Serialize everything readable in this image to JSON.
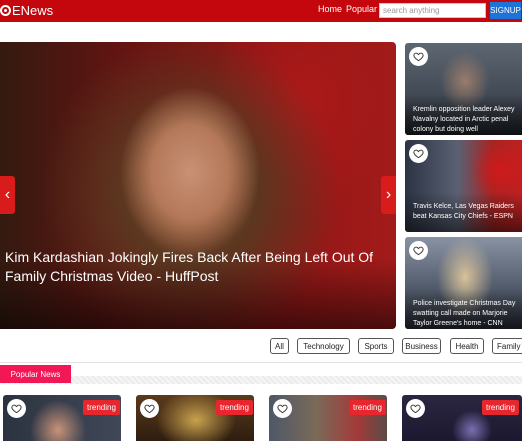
{
  "header": {
    "logo_text": "ENews",
    "nav": [
      "Home",
      "Popular"
    ],
    "search_placeholder": "search anything",
    "signup_label": "SIGNUP",
    "bg_color": "#c4070d"
  },
  "hero": {
    "title": "Kim Kardashian Jokingly Fires Back After Being Left Out Of Family Christmas Video - HuffPost",
    "prev_icon": "chevron-left-icon",
    "next_icon": "chevron-right-icon",
    "arrow_color": "#d81c1c"
  },
  "side_articles": [
    {
      "title": "Kremlin opposition leader Alexey Navalny located in Arctic penal colony but doing well",
      "icon": "heart-icon"
    },
    {
      "title": "Travis Kelce, Las Vegas Raiders beat Kansas City Chiefs - ESPN",
      "icon": "heart-icon"
    },
    {
      "title": "Police investigate Christmas Day swatting call made on Marjorie Taylor Greene's home - CNN",
      "icon": "heart-icon"
    }
  ],
  "categories": [
    "All",
    "Technology",
    "Sports",
    "Business",
    "Health",
    "Family"
  ],
  "popular": {
    "label": "Popular News",
    "label_color": "#f21856",
    "badge": "trending",
    "badge_color": "#e8262e",
    "cards": [
      {
        "icon": "heart-icon",
        "badge": "trending"
      },
      {
        "icon": "heart-icon",
        "badge": "trending"
      },
      {
        "icon": "heart-icon",
        "badge": "trending"
      },
      {
        "icon": "heart-icon",
        "badge": "trending"
      }
    ]
  }
}
